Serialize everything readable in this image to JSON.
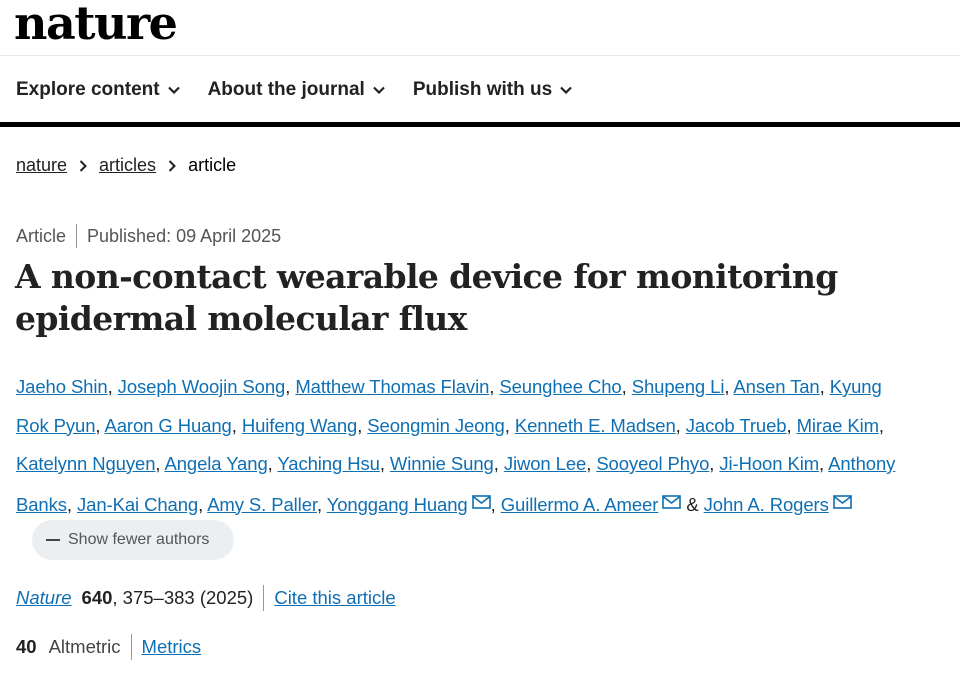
{
  "site": {
    "logo": "nature"
  },
  "nav": {
    "items": [
      {
        "label": "Explore content"
      },
      {
        "label": "About the journal"
      },
      {
        "label": "Publish with us"
      }
    ]
  },
  "breadcrumb": {
    "root": "nature",
    "section": "articles",
    "current": "article"
  },
  "article": {
    "type": "Article",
    "published": "Published: 09 April 2025",
    "title_line1": "A non-contact wearable device for monitoring",
    "title_line2": "epidermal molecular flux",
    "authors": [
      "Jaeho Shin",
      "Joseph Woojin Song",
      "Matthew Thomas Flavin",
      "Seunghee Cho",
      "Shupeng Li",
      "Ansen Tan",
      "Kyung",
      "Rok Pyun",
      "Aaron G Huang",
      "Huifeng Wang",
      "Seongmin Jeong",
      "Kenneth E. Madsen",
      "Jacob Trueb",
      "Mirae Kim",
      "Katelynn Nguyen",
      "Angela Yang",
      "Yaching Hsu",
      "Winnie Sung",
      "Jiwon Lee",
      "Sooyeol Phyo",
      "Ji-Hoon Kim",
      "Anthony",
      "Banks",
      "Jan-Kai Chang",
      "Amy S. Paller",
      "Yonggang Huang",
      "Guillermo A. Ameer",
      "John A. Rogers"
    ],
    "separators": {
      "comma": ",",
      "ampersand": "&"
    },
    "show_fewer_label": "Show fewer authors",
    "journal": "Nature",
    "volume": "640",
    "pages_year": ", 375–383 (2025)",
    "cite_label": "Cite this article",
    "altmetric_score": "40",
    "altmetric_label": "Altmetric",
    "metrics_label": "Metrics"
  }
}
